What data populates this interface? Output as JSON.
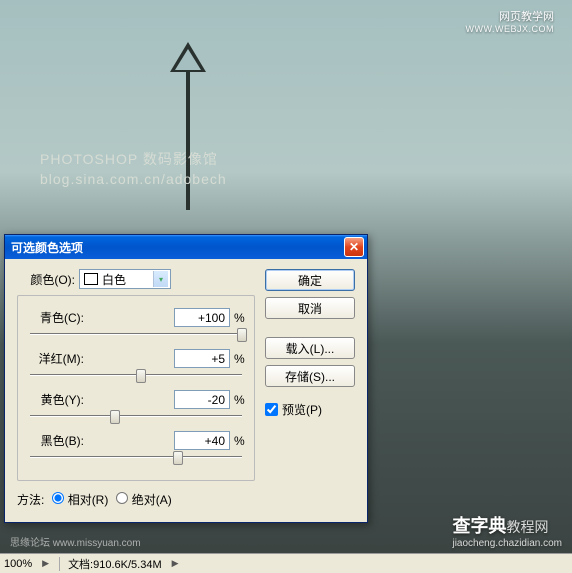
{
  "watermarks": {
    "top_line1": "网页教学网",
    "top_line2": "WWW.WEBJX.COM",
    "mid_line1": "PHOTOSHOP 数码影像馆",
    "mid_line2": "blog.sina.com.cn/adobech",
    "bottom_right": "查字典",
    "bottom_right_sub": "教程网",
    "bottom_right_caption": "jiaocheng.chazidian.com",
    "bottom_left": "思缘论坛  www.missyuan.com"
  },
  "dialog": {
    "title": "可选颜色选项",
    "color_label": "颜色(O):",
    "color_value": "白色",
    "sliders": {
      "cyan": {
        "label": "青色(C):",
        "value": "+100",
        "pos": 100
      },
      "magenta": {
        "label": "洋红(M):",
        "value": "+5",
        "pos": 52.5
      },
      "yellow": {
        "label": "黄色(Y):",
        "value": "-20",
        "pos": 40
      },
      "black": {
        "label": "黑色(B):",
        "value": "+40",
        "pos": 70
      }
    },
    "percent": "%",
    "method_label": "方法:",
    "method_relative": "相对(R)",
    "method_absolute": "绝对(A)",
    "buttons": {
      "ok": "确定",
      "cancel": "取消",
      "load": "载入(L)...",
      "save": "存储(S)..."
    },
    "preview": "预览(P)"
  },
  "status": {
    "zoom": "100%",
    "doc": "文档:910.6K/5.34M"
  }
}
